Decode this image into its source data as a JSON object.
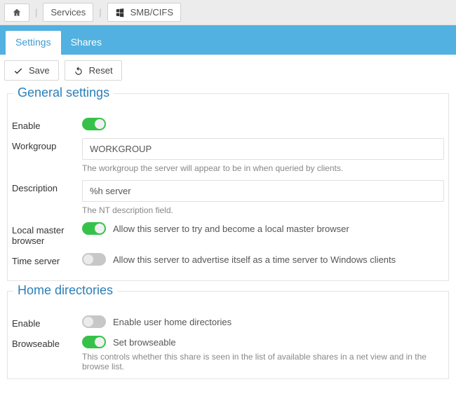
{
  "breadcrumb": {
    "services_label": "Services",
    "smb_label": "SMB/CIFS"
  },
  "tabs": {
    "settings": "Settings",
    "shares": "Shares"
  },
  "toolbar": {
    "save_label": "Save",
    "reset_label": "Reset"
  },
  "general": {
    "title": "General settings",
    "enable": {
      "label": "Enable",
      "on": true
    },
    "workgroup": {
      "label": "Workgroup",
      "value": "WORKGROUP",
      "hint": "The workgroup the server will appear to be in when queried by clients."
    },
    "description": {
      "label": "Description",
      "value": "%h server",
      "hint": "The NT description field."
    },
    "local_master": {
      "label": "Local master browser",
      "on": true,
      "side": "Allow this server to try and become a local master browser"
    },
    "time_server": {
      "label": "Time server",
      "on": false,
      "side": "Allow this server to advertise itself as a time server to Windows clients"
    }
  },
  "homedirs": {
    "title": "Home directories",
    "enable": {
      "label": "Enable",
      "on": false,
      "side": "Enable user home directories"
    },
    "browseable": {
      "label": "Browseable",
      "on": true,
      "side": "Set browseable",
      "hint": "This controls whether this share is seen in the list of available shares in a net view and in the browse list."
    }
  }
}
